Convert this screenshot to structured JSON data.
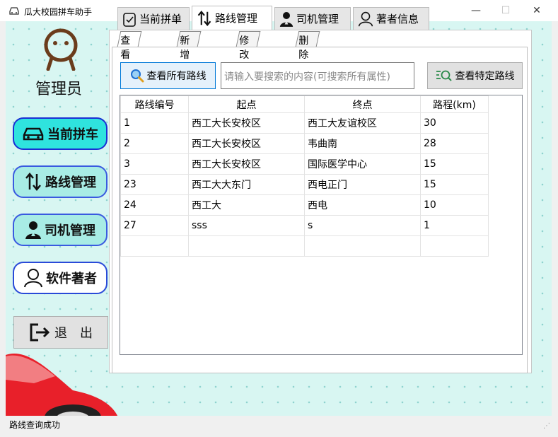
{
  "window": {
    "title": "瓜大校园拼车助手"
  },
  "sidebar": {
    "role": "管理员",
    "nav": [
      {
        "label": "当前拼车"
      },
      {
        "label": "路线管理"
      },
      {
        "label": "司机管理"
      },
      {
        "label": "软件著者"
      }
    ],
    "exit_label": "退　出"
  },
  "tabs": [
    {
      "label": "当前拼单"
    },
    {
      "label": "路线管理"
    },
    {
      "label": "司机管理"
    },
    {
      "label": "著者信息"
    }
  ],
  "subtabs": [
    {
      "label": "查看路线"
    },
    {
      "label": "新增路线"
    },
    {
      "label": "修改路线"
    },
    {
      "label": "删除路线"
    }
  ],
  "toolbar": {
    "view_all_label": "查看所有路线",
    "search_placeholder": "请输入要搜索的内容(可搜索所有属性)",
    "view_specific_label": "查看特定路线"
  },
  "table": {
    "headers": [
      "路线编号",
      "起点",
      "终点",
      "路程(km)"
    ],
    "rows": [
      [
        "1",
        "西工大长安校区",
        "西工大友谊校区",
        "30"
      ],
      [
        "2",
        "西工大长安校区",
        "韦曲南",
        "28"
      ],
      [
        "3",
        "西工大长安校区",
        "国际医学中心",
        "15"
      ],
      [
        "23",
        "西工大大东门",
        "西电正门",
        "15"
      ],
      [
        "24",
        "西工大",
        "西电",
        "10"
      ],
      [
        "27",
        "sss",
        "s",
        "1"
      ],
      [
        "",
        "",
        "",
        ""
      ]
    ]
  },
  "status": {
    "text": "路线查询成功"
  },
  "colors": {
    "accent_active": "#2fe3de",
    "panel_bg": "#d8f6f2",
    "car_red": "#e8202a"
  }
}
